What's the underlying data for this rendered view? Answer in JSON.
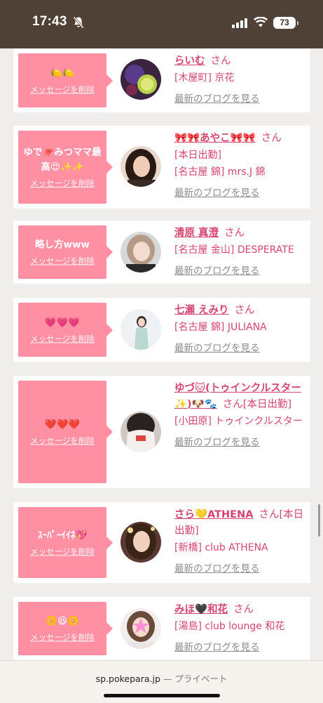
{
  "status_bar": {
    "time": "17:43",
    "battery": "73",
    "icons": [
      "bell-slash-icon",
      "signal-icon",
      "wifi-icon",
      "battery-icon"
    ]
  },
  "delete_label": "メッセージを削除",
  "blog_label": "最新のブログを見る",
  "san_label": "さん",
  "cards": [
    {
      "message": "🍋🍋",
      "name": "らいむ",
      "name_suffix": "",
      "shop_lines": [
        "[木屋町] 京花"
      ]
    },
    {
      "message": "ゆで🐙みつママ最高😍✨✨",
      "name": "🎀🎀あやこ🎀🎀",
      "name_suffix": "",
      "shop_lines": [
        "[本日出勤]",
        "[名古屋 錦] mrs.J 錦"
      ]
    },
    {
      "message": "略し方www",
      "name": "清原 真澄",
      "name_suffix": "",
      "shop_lines": [
        "[名古屋 金山] DESPERATE"
      ]
    },
    {
      "message": "💗💗💗",
      "name": "七瀬 えみり",
      "name_suffix": "",
      "shop_lines": [
        "[名古屋 錦] JULIANA"
      ]
    },
    {
      "message": "❤️❤️❤️",
      "name": "ゆづ🐱(トゥインクルスター✨)🐶🐾",
      "name_suffix": "[本日出勤]",
      "shop_lines": [
        "[小田原] トゥインクルスター"
      ]
    },
    {
      "message": "ｽｰﾊﾟｰｲｲﾈ💖",
      "name": "さら💛ATHENA",
      "name_suffix": "[本日出勤]",
      "shop_lines": [
        "[新橋] club ATHENA"
      ]
    },
    {
      "message": "🌼😆🌼",
      "name": "みほ🖤和花",
      "name_suffix": "",
      "shop_lines": [
        "[湯島] club lounge 和花"
      ]
    }
  ],
  "bottom_bar": {
    "url": "sp.pokepara.jp",
    "separator": "—",
    "mode": "プライベート"
  },
  "colors": {
    "accent_pink": "#ff8fa2",
    "name_pink": "#d6456f",
    "status_bar_bg": "#4f4136",
    "page_bg": "#f0eded"
  }
}
